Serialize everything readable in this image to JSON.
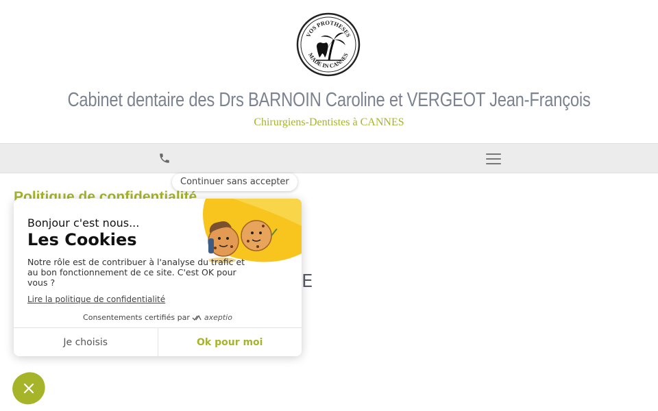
{
  "header": {
    "logo_text_top": "VOS PROTHESES",
    "logo_text_bottom": "MADE IN CANNES",
    "title": "Cabinet dentaire des Drs BARNOIN Caroline et VERGEOT Jean-François",
    "subtitle": "Chirurgiens-Dentistes à CANNES"
  },
  "navbar": {
    "phone_icon": "phone-icon",
    "menu_icon": "hamburger-menu-icon"
  },
  "main": {
    "heading": "Politique de confidentialité",
    "partial_text": "E"
  },
  "cookie_banner": {
    "continue_label": "Continuer sans accepter",
    "greeting": "Bonjour c'est nous...",
    "title": "Les Cookies",
    "description": "Notre rôle est de contribuer à l'analyse du trafic et au bon fonctionnement de ce site. C'est OK pour vous ?",
    "policy_link": "Lire la politique de confidentialité",
    "certified_prefix": "Consentements certifiés par",
    "certified_brand": "axeptio",
    "choose_label": "Je choisis",
    "ok_label": "Ok pour moi"
  },
  "colors": {
    "accent": "#a6b42a",
    "title_gray": "#7b8290",
    "navbar_bg": "#ececec",
    "illustration_yellow": "#f7c51e"
  }
}
